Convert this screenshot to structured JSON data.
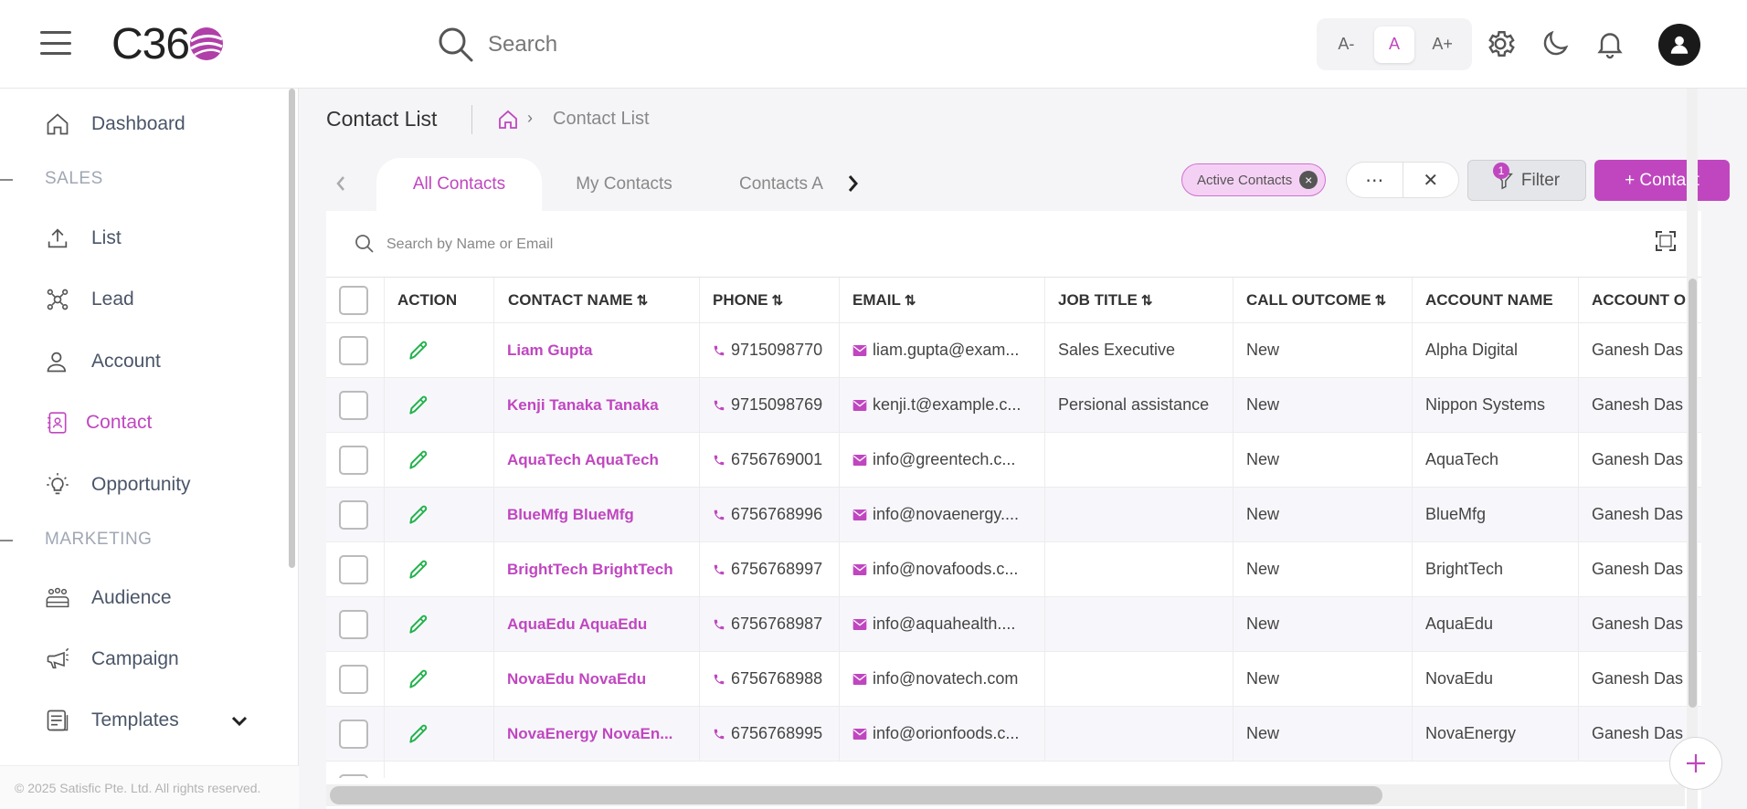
{
  "header": {
    "logo_text": "C36",
    "search_placeholder": "Search",
    "font_sizes": [
      "A-",
      "A",
      "A+"
    ]
  },
  "sidebar": {
    "items": [
      {
        "label": "Dashboard",
        "icon": "home-icon"
      },
      {
        "label": "List",
        "icon": "upload-icon"
      },
      {
        "label": "Lead",
        "icon": "network-icon"
      },
      {
        "label": "Account",
        "icon": "user-icon"
      },
      {
        "label": "Contact",
        "icon": "contact-book-icon"
      },
      {
        "label": "Opportunity",
        "icon": "lightbulb-icon"
      },
      {
        "label": "Audience",
        "icon": "group-icon"
      },
      {
        "label": "Campaign",
        "icon": "megaphone-icon"
      },
      {
        "label": "Templates",
        "icon": "template-icon"
      }
    ],
    "sections": [
      "SALES",
      "MARKETING"
    ],
    "footer": "© 2025 Satisfic Pte. Ltd. All rights reserved."
  },
  "page": {
    "title": "Contact List",
    "breadcrumb_current": "Contact List"
  },
  "tabs": [
    "All Contacts",
    "My Contacts",
    "Contacts A"
  ],
  "toolbar": {
    "chip_label": "Active Contacts",
    "filter_label": "Filter",
    "filter_count": "1",
    "add_label": "+ Contact",
    "table_search_placeholder": "Search by Name or Email"
  },
  "table": {
    "headers": [
      "ACTION",
      "CONTACT NAME",
      "PHONE",
      "EMAIL",
      "JOB TITLE",
      "CALL OUTCOME",
      "ACCOUNT NAME",
      "ACCOUNT O"
    ],
    "rows": [
      {
        "name": "Liam Gupta",
        "phone": "9715098770",
        "email": "liam.gupta@exam...",
        "job": "Sales Executive",
        "outcome": "New",
        "account": "Alpha Digital",
        "owner": "Ganesh Das"
      },
      {
        "name": "Kenji Tanaka Tanaka",
        "phone": "9715098769",
        "email": "kenji.t@example.c...",
        "job": "Persional assistance",
        "outcome": "New",
        "account": "Nippon Systems",
        "owner": "Ganesh Das"
      },
      {
        "name": "AquaTech AquaTech",
        "phone": "6756769001",
        "email": "info@greentech.c...",
        "job": "",
        "outcome": "New",
        "account": "AquaTech",
        "owner": "Ganesh Das"
      },
      {
        "name": "BlueMfg BlueMfg",
        "phone": "6756768996",
        "email": "info@novaenergy....",
        "job": "",
        "outcome": "New",
        "account": "BlueMfg",
        "owner": "Ganesh Das"
      },
      {
        "name": "BrightTech BrightTech",
        "phone": "6756768997",
        "email": "info@novafoods.c...",
        "job": "",
        "outcome": "New",
        "account": "BrightTech",
        "owner": "Ganesh Das"
      },
      {
        "name": "AquaEdu AquaEdu",
        "phone": "6756768987",
        "email": "info@aquahealth....",
        "job": "",
        "outcome": "New",
        "account": "AquaEdu",
        "owner": "Ganesh Das"
      },
      {
        "name": "NovaEdu NovaEdu",
        "phone": "6756768988",
        "email": "info@novatech.com",
        "job": "",
        "outcome": "New",
        "account": "NovaEdu",
        "owner": "Ganesh Das"
      },
      {
        "name": "NovaEnergy NovaEn...",
        "phone": "6756768995",
        "email": "info@orionfoods.c...",
        "job": "",
        "outcome": "New",
        "account": "NovaEnergy",
        "owner": "Ganesh Das"
      }
    ]
  },
  "colors": {
    "accent": "#c046c0",
    "edit_green": "#22b24c"
  }
}
